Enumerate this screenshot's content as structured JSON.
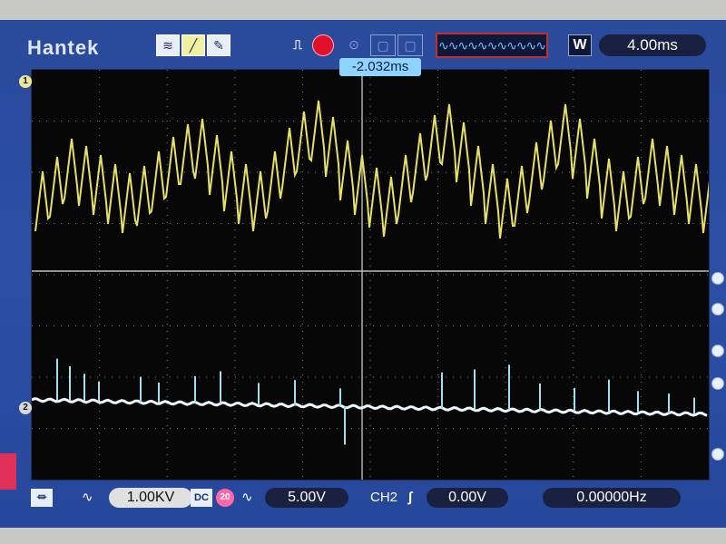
{
  "header": {
    "brand": "Hantek",
    "timebase": "4.00ms",
    "trigger_position": "-2.032ms",
    "mode": "W",
    "icons": [
      "acquire-icon",
      "measure-icon",
      "cursor-icon",
      "trigger-edge-icon",
      "run-stop-icon",
      "save-icon",
      "cursor-menu-icon"
    ]
  },
  "channels": {
    "ch1": {
      "label": "1",
      "scale": "1.00KV",
      "color": "#e8e060"
    },
    "ch2": {
      "label": "2",
      "scale": "5.00V",
      "coupling": "DC",
      "bw": "20",
      "color": "#cfeef5"
    }
  },
  "trigger": {
    "source": "CH2",
    "level": "0.00V",
    "frequency": "0.00000Hz"
  },
  "colors": {
    "bezel": "#2c4fa6",
    "screen": "#070707",
    "grid": "#7d7d7d",
    "accent": "#8fd3ff"
  }
}
